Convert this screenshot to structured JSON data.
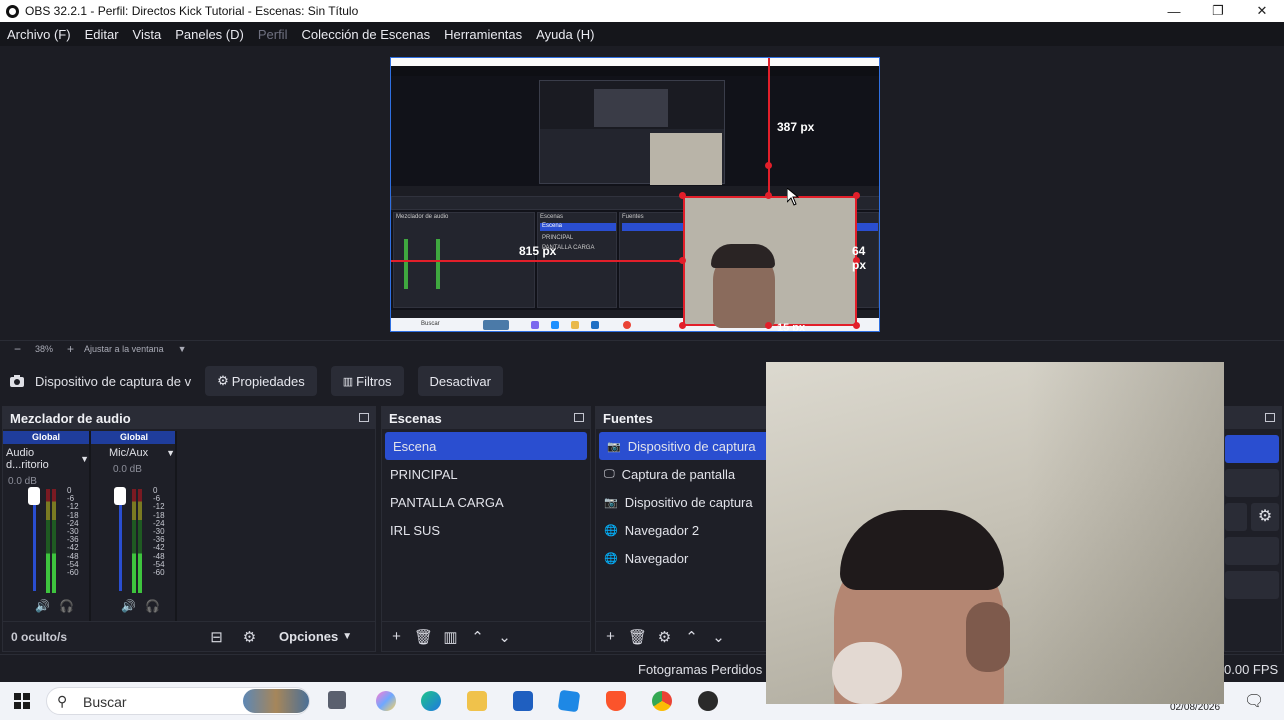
{
  "window": {
    "title": "OBS 32.2.1 - Perfil: Directos Kick Tutorial - Escenas: Sin Título",
    "minimize_glyph": "—",
    "maximize_glyph": "❐",
    "close_glyph": "✕"
  },
  "menu": {
    "items": [
      "Archivo (F)",
      "Editar",
      "Vista",
      "Paneles (D)",
      "Perfil",
      "Colección de Escenas",
      "Herramientas",
      "Ayuda (H)"
    ]
  },
  "preview": {
    "measure_top": "387 px",
    "measure_left": "815 px",
    "measure_right": "64 px",
    "measure_bottom": "15 px",
    "nested_labels": {
      "mixer": "Mezclador de audio",
      "scenes": "Escenas",
      "sources": "Fuentes",
      "scene_selected": "Escena",
      "scene_2": "PRINCIPAL",
      "scene_3": "PANTALLA CARGA",
      "search": "Buscar"
    }
  },
  "zoombar": {
    "minus": "−",
    "zoom": "38%",
    "plus": "+",
    "fit_label": "Ajustar a la ventana",
    "dropdown": "▼"
  },
  "source_toolbar": {
    "source_name": "Dispositivo de captura de v",
    "properties_label": "Propiedades",
    "filters_label": "Filtros",
    "deactivate_label": "Desactivar"
  },
  "mixer": {
    "title": "Mezclador de audio",
    "channels": [
      {
        "badge": "Global",
        "name": "Audio d...ritorio",
        "db": "0.0 dB"
      },
      {
        "badge": "Global",
        "name": "Mic/Aux",
        "db": "0.0 dB"
      }
    ],
    "scale": [
      "0",
      "-6",
      "-12",
      "-18",
      "-24",
      "-30",
      "-36",
      "-42",
      "-48",
      "-54",
      "-60"
    ],
    "hidden_label": "0 oculto/s",
    "options_label": "Opciones"
  },
  "scenes": {
    "title": "Escenas",
    "items": [
      "Escena",
      "PRINCIPAL",
      "PANTALLA CARGA",
      "IRL SUS"
    ],
    "selected_index": 0
  },
  "sources": {
    "title": "Fuentes",
    "items": [
      {
        "label": "Dispositivo de captura",
        "icon": "camera-icon"
      },
      {
        "label": "Captura de pantalla",
        "icon": "monitor-icon"
      },
      {
        "label": "Dispositivo de captura",
        "icon": "camera-icon"
      },
      {
        "label": "Navegador 2",
        "icon": "globe-icon"
      },
      {
        "label": "Navegador",
        "icon": "globe-icon"
      }
    ],
    "selected_index": 0
  },
  "status": {
    "dropped_frames": "Fotogramas Perdidos 7",
    "fps": "0.00 FPS"
  },
  "taskbar": {
    "search_placeholder": "Buscar",
    "date": "02/08/2026"
  },
  "colors": {
    "accent": "#2a4ed0",
    "selection_red": "#e21f2a",
    "dock_bg": "#1e1f27"
  }
}
